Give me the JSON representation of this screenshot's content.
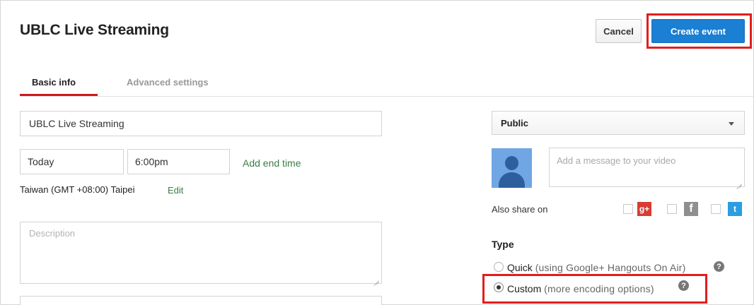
{
  "header": {
    "title": "UBLC Live Streaming",
    "cancel_label": "Cancel",
    "create_label": "Create event"
  },
  "tabs": [
    {
      "label": "Basic info",
      "active": true
    },
    {
      "label": "Advanced settings",
      "active": false
    }
  ],
  "basic": {
    "title_value": "UBLC Live Streaming",
    "date_value": "Today",
    "time_value": "6:00pm",
    "add_end_time": "Add end time",
    "timezone": "Taiwan (GMT +08:00) Taipei",
    "timezone_edit": "Edit",
    "description_placeholder": "Description"
  },
  "privacy": {
    "selected": "Public"
  },
  "share": {
    "message_placeholder": "Add a message to your video",
    "also_share_label": "Also share on",
    "networks": [
      "google-plus-icon",
      "facebook-icon",
      "twitter-icon"
    ]
  },
  "type": {
    "label": "Type",
    "options": [
      {
        "name": "Quick",
        "detail": "(using Google+ Hangouts On Air)",
        "selected": false
      },
      {
        "name": "Custom",
        "detail": "(more encoding options)",
        "selected": true
      }
    ]
  },
  "colors": {
    "primary_button": "#1b7fd3",
    "highlight_box": "#e01e1e",
    "active_tab": "#cc181e",
    "link": "#3a7c44"
  }
}
